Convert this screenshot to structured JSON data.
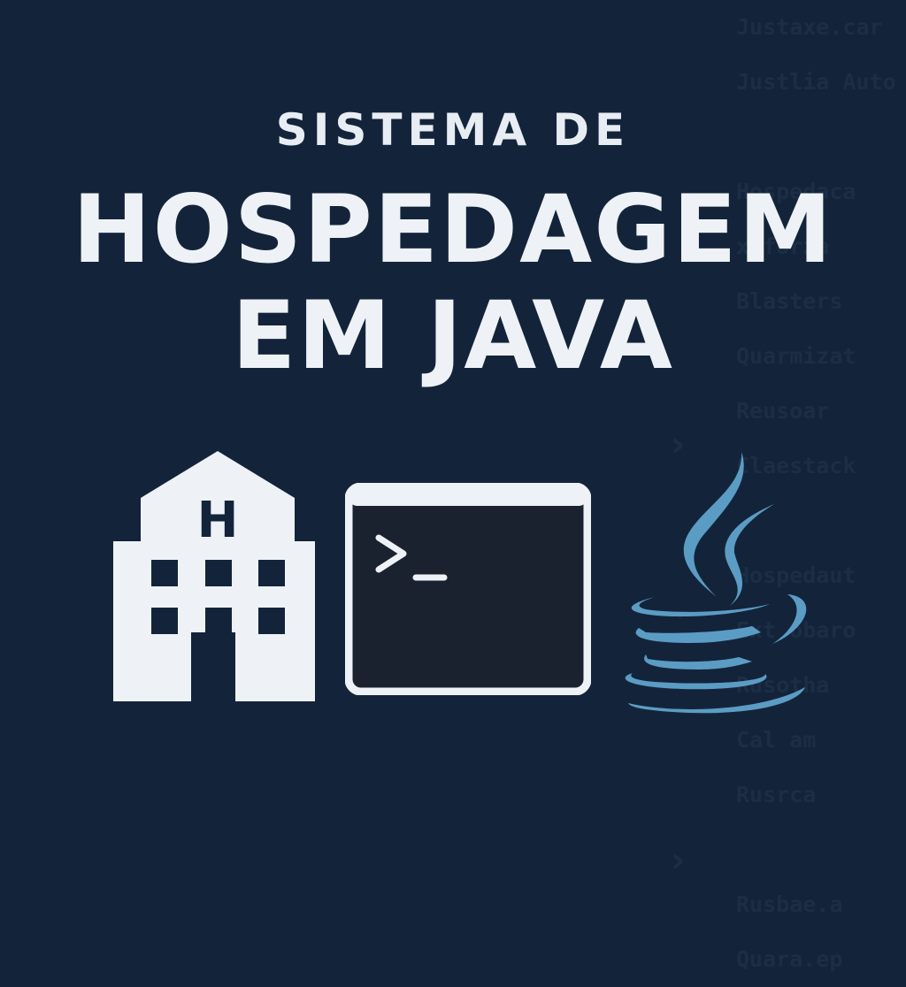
{
  "title": {
    "line1": "SISTEMA DE",
    "line2": "HOSPEDAGEM",
    "line3": "EM JAVA"
  },
  "icons": {
    "hotel": "hotel-building-icon",
    "hotel_letter": "H",
    "terminal": "terminal-icon",
    "java": "java-coffee-cup-icon"
  },
  "background_code": [
    "Justaxe.car",
    "Justlia Auto",
    "",
    "Hospedaca",
    "x.forza",
    "Blasters",
    "Quarmizat",
    "Reusoar",
    "Claestack",
    "",
    "Hospedaut",
    "Ext obaro",
    "Rusotha",
    "Cal am",
    "Rusrca",
    "",
    "Rusbae.a",
    "Quara.ep"
  ],
  "colors": {
    "background": "#13243a",
    "text": "#eef2f7",
    "java_blue": "#5b9cc4",
    "terminal_screen": "#1a2230"
  }
}
